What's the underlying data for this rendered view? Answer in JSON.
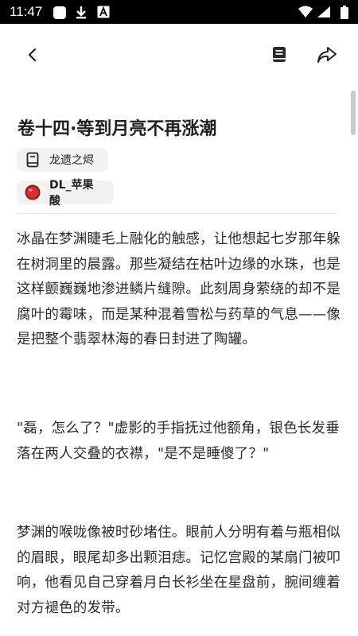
{
  "status_bar": {
    "time": "11:47",
    "notification_icons": [
      "app-tile-icon",
      "download-icon",
      "a-badge-icon"
    ],
    "system_icons": [
      "wifi-icon",
      "signal-icon",
      "battery-icon"
    ]
  },
  "app_bar": {
    "back_icon": "chevron-left-icon",
    "toc_icon": "book-icon",
    "share_icon": "share-icon"
  },
  "article": {
    "title": "卷十四·等到月亮不再涨潮",
    "book_name": "龙遗之烬",
    "author_name": "DL_苹果酸",
    "paragraphs": [
      "冰晶在梦渊睫毛上融化的触感，让他想起七岁那年躲在树洞里的晨露。那些凝结在枯叶边缘的水珠，也是这样颤巍巍地渗进鳞片缝隙。此刻周身萦绕的却不是腐叶的霉味，而是某种混着雪松与药草的气息——像是把整个翡翠林海的春日封进了陶罐。",
      "\"磊，怎么了？\"虚影的手指抚过他额角，银色长发垂落在两人交叠的衣襟，\"是不是睡傻了？\"",
      "梦渊的喉咙像被时砂堵住。眼前人分明有着与瓶相似的眉眼，眼尾却多出颗泪痣。记忆宫殿的某扇门被叩响，他看见自己穿着月白长衫坐在星盘前，腕间缠着对方褪色的发带。"
    ]
  },
  "colors": {
    "status_bar_bg": "#000000",
    "chip_bg": "#f2f2f2",
    "text": "#2b2b2b",
    "avatar": "#c62828"
  }
}
